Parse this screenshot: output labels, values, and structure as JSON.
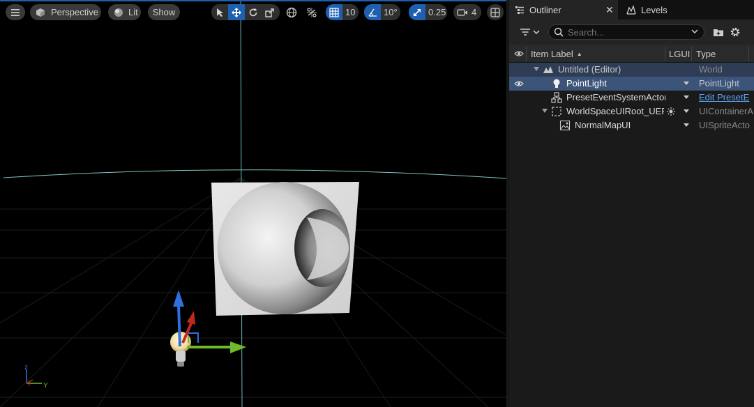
{
  "viewport": {
    "menu_icon": "hamburger-icon",
    "perspective_label": "Perspective",
    "lit_label": "Lit",
    "show_label": "Show",
    "grid_snap_value": "10",
    "rotation_snap_value": "10°",
    "scale_snap_value": "0.25",
    "camera_speed_value": "4",
    "accent": "#1f5fb0"
  },
  "outliner": {
    "tabs": [
      {
        "label": "Outliner",
        "icon": "outliner-icon"
      },
      {
        "label": "Levels",
        "icon": "levels-icon"
      }
    ],
    "search_placeholder": "Search...",
    "columns": {
      "item_label": "Item Label",
      "lgui": "LGUI",
      "type": "Type"
    },
    "rows": [
      {
        "label": "Untitled (Editor)",
        "type": "World",
        "icon": "world-icon"
      },
      {
        "label": "PointLight",
        "type": "PointLight",
        "icon": "lightbulb-icon"
      },
      {
        "label": "PresetEventSystemActor",
        "type": "Edit PresetE",
        "icon": "actor-icon"
      },
      {
        "label": "WorldSpaceUIRoot_UERe",
        "type": "UIContainerA",
        "icon": "ui-container-icon"
      },
      {
        "label": "NormalMapUI",
        "type": "UISpriteActo",
        "icon": "ui-sprite-icon"
      }
    ]
  }
}
